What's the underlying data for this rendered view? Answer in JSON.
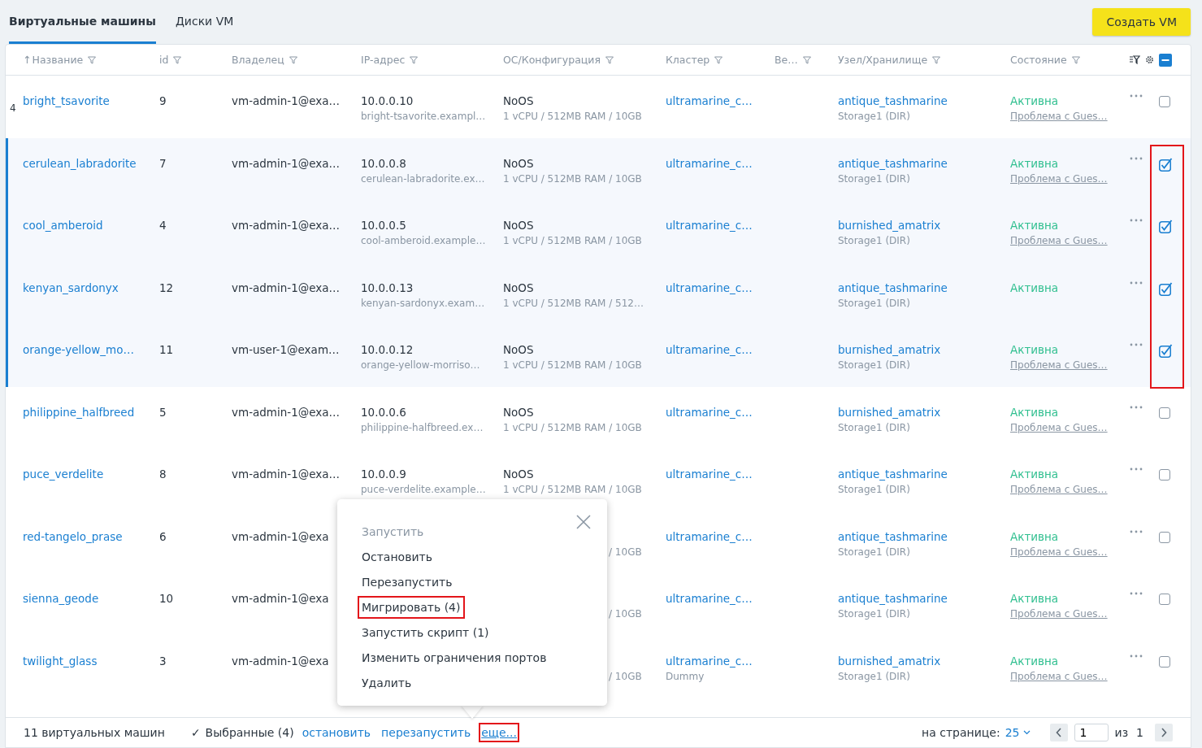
{
  "tabs": [
    {
      "label": "Виртуальные машины",
      "selected": true
    },
    {
      "label": "Диски VM",
      "selected": false
    }
  ],
  "create_button": "Создать VM",
  "table": {
    "columns": [
      {
        "label": "Название",
        "sort": "↑"
      },
      {
        "label": "id"
      },
      {
        "label": "Владелец"
      },
      {
        "label": "IP-адрес"
      },
      {
        "label": "ОС/Конфигурация"
      },
      {
        "label": "Кластер"
      },
      {
        "label": "Ве…"
      },
      {
        "label": "Узел/Хранилище"
      },
      {
        "label": "Состояние"
      }
    ],
    "select_all_indeterminate": true,
    "checkbox_column_highlighted": true,
    "rows": [
      {
        "marker": "4",
        "name": "bright_tsavorite",
        "id": "9",
        "owner": "vm-admin-1@exa…",
        "ip": "10.0.0.10",
        "host": "bright-tsavorite.exampl…",
        "os": "NoOS",
        "config": "1 vCPU / 512MB RAM / 10GB",
        "cluster": "ultramarine_c…",
        "node": "antique_tashmarine",
        "storage": "Storage1 (DIR)",
        "state": "Активна",
        "issue": "Проблема с Gues…",
        "checked": false
      },
      {
        "name": "cerulean_labradorite",
        "id": "7",
        "owner": "vm-admin-1@exa…",
        "ip": "10.0.0.8",
        "host": "cerulean-labradorite.ex…",
        "os": "NoOS",
        "config": "1 vCPU / 512MB RAM / 10GB",
        "cluster": "ultramarine_c…",
        "node": "antique_tashmarine",
        "storage": "Storage1 (DIR)",
        "state": "Активна",
        "issue": "Проблема с Gues…",
        "checked": true
      },
      {
        "name": "cool_amberoid",
        "id": "4",
        "owner": "vm-admin-1@exa…",
        "ip": "10.0.0.5",
        "host": "cool-amberoid.example…",
        "os": "NoOS",
        "config": "1 vCPU / 512MB RAM / 10GB",
        "cluster": "ultramarine_c…",
        "node": "burnished_amatrix",
        "storage": "Storage1 (DIR)",
        "state": "Активна",
        "issue": "Проблема с Gues…",
        "checked": true
      },
      {
        "name": "kenyan_sardonyx",
        "id": "12",
        "owner": "vm-admin-1@exa…",
        "ip": "10.0.0.13",
        "host": "kenyan-sardonyx.exam…",
        "os": "NoOS",
        "config": "1 vCPU / 512MB RAM / 512…",
        "cluster": "ultramarine_c…",
        "node": "antique_tashmarine",
        "storage": "Storage1 (DIR)",
        "state": "Активна",
        "checked": true
      },
      {
        "name": "orange-yellow_mo…",
        "id": "11",
        "owner": "vm-user-1@exam…",
        "ip": "10.0.0.12",
        "host": "orange-yellow-morriso…",
        "os": "NoOS",
        "config": "1 vCPU / 512MB RAM / 10GB",
        "cluster": "ultramarine_c…",
        "node": "burnished_amatrix",
        "storage": "Storage1 (DIR)",
        "state": "Активна",
        "issue": "Проблема с Gues…",
        "checked": true
      },
      {
        "name": "philippine_halfbreed",
        "id": "5",
        "owner": "vm-admin-1@exa…",
        "ip": "10.0.0.6",
        "host": "philippine-halfbreed.ex…",
        "os": "NoOS",
        "config": "1 vCPU / 512MB RAM / 10GB",
        "cluster": "ultramarine_c…",
        "node": "burnished_amatrix",
        "storage": "Storage1 (DIR)",
        "state": "Активна",
        "issue": "Проблема с Gues…",
        "checked": false
      },
      {
        "name": "puce_verdelite",
        "id": "8",
        "owner": "vm-admin-1@exa…",
        "ip": "10.0.0.9",
        "host": "puce-verdelite.example…",
        "os": "NoOS",
        "config": "1 vCPU / 512MB RAM / 10GB",
        "cluster": "ultramarine_c…",
        "node": "antique_tashmarine",
        "storage": "Storage1 (DIR)",
        "state": "Активна",
        "issue": "Проблема с Gues…",
        "checked": false
      },
      {
        "name": "red-tangelo_prase",
        "id": "6",
        "owner": "vm-admin-1@exa",
        "config": "/ 10GB",
        "cluster": "ultramarine_c…",
        "node": "antique_tashmarine",
        "storage": "Storage1 (DIR)",
        "state": "Активна",
        "issue": "Проблема с Gues…",
        "checked": false
      },
      {
        "name": "sienna_geode",
        "id": "10",
        "owner": "vm-admin-1@exa",
        "config": "/ 10GB",
        "cluster": "ultramarine_c…",
        "node": "antique_tashmarine",
        "storage": "Storage1 (DIR)",
        "state": "Активна",
        "issue": "Проблема с Gues…",
        "checked": false
      },
      {
        "name": "twilight_glass",
        "id": "3",
        "owner": "vm-admin-1@exa",
        "config": "/ 10GB",
        "cluster": "ultramarine_c…",
        "cluster_sub": "Dummy",
        "node": "burnished_amatrix",
        "storage": "Storage1 (DIR)",
        "state": "Активна",
        "issue": "Проблема с Gues…",
        "checked": false
      }
    ]
  },
  "actions_menu": {
    "items": [
      {
        "label": "Запустить",
        "disabled": true,
        "highlighted": false
      },
      {
        "label": "Остановить",
        "disabled": false,
        "highlighted": false
      },
      {
        "label": "Перезапустить",
        "disabled": false,
        "highlighted": false
      },
      {
        "label": "Мигрировать (4)",
        "disabled": false,
        "highlighted": true
      },
      {
        "label": "Запустить скрипт (1)",
        "disabled": false,
        "highlighted": false
      },
      {
        "label": "Изменить ограничения портов",
        "disabled": false,
        "highlighted": false
      },
      {
        "label": "Удалить",
        "disabled": false,
        "highlighted": false
      }
    ]
  },
  "footer": {
    "total": "11 виртуальных машин",
    "selected_mark": "✓",
    "selected": "Выбранные (4)",
    "links": [
      {
        "label": "остановить",
        "highlighted": false
      },
      {
        "label": "перезапустить",
        "highlighted": false
      },
      {
        "label": "еще...",
        "highlighted": true
      }
    ],
    "per_page_label": "на странице:",
    "per_page": "25",
    "page": "1",
    "of_label": "из",
    "pages": "1"
  }
}
